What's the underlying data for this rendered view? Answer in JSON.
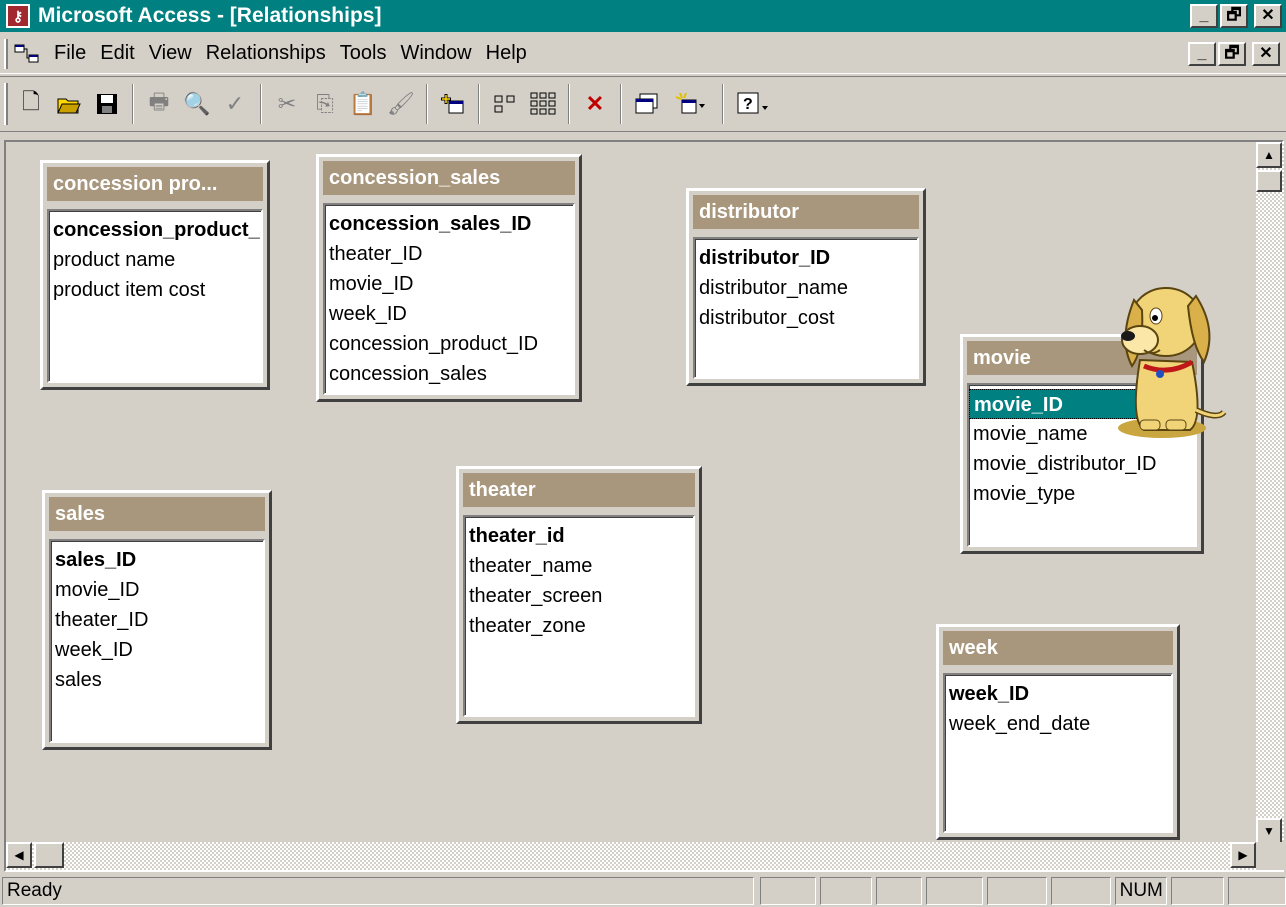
{
  "window": {
    "title": "Microsoft Access - [Relationships]",
    "app_icon": "access-key-icon",
    "minimize": "_",
    "maximize": "🗗",
    "close": "✕"
  },
  "menu": {
    "items": [
      {
        "label": "File"
      },
      {
        "label": "Edit"
      },
      {
        "label": "View"
      },
      {
        "label": "Relationships"
      },
      {
        "label": "Tools"
      },
      {
        "label": "Window"
      },
      {
        "label": "Help"
      }
    ]
  },
  "toolbar": {
    "buttons": [
      "new-icon",
      "open-icon",
      "save-icon",
      "print-icon",
      "print-preview-icon",
      "spelling-icon",
      "cut-icon",
      "copy-icon",
      "paste-icon",
      "format-painter-icon",
      "show-table-icon",
      "show-direct-icon",
      "show-all-icon",
      "delete-icon",
      "database-window-icon",
      "new-object-icon",
      "help-icon"
    ]
  },
  "tables": {
    "concession_product": {
      "title": "concession pro...",
      "fields": [
        "concession_product_",
        "product name",
        "product item cost"
      ]
    },
    "concession_sales": {
      "title": "concession_sales",
      "fields": [
        "concession_sales_ID",
        "theater_ID",
        "movie_ID",
        "week_ID",
        "concession_product_ID",
        "concession_sales"
      ]
    },
    "distributor": {
      "title": "distributor",
      "fields": [
        "distributor_ID",
        "distributor_name",
        "distributor_cost"
      ]
    },
    "movie": {
      "title": "movie",
      "fields": [
        "movie_ID",
        "movie_name",
        "movie_distributor_ID",
        "movie_type"
      ]
    },
    "sales": {
      "title": "sales",
      "fields": [
        "sales_ID",
        "movie_ID",
        "theater_ID",
        "week_ID",
        "sales"
      ]
    },
    "theater": {
      "title": "theater",
      "fields": [
        "theater_id",
        "theater_name",
        "theater_screen",
        "theater_zone"
      ]
    },
    "week": {
      "title": "week",
      "fields": [
        "week_ID",
        "week_end_date"
      ]
    }
  },
  "statusbar": {
    "message": "Ready",
    "num": "NUM"
  },
  "colors": {
    "titlebar": "#008080",
    "table_header": "#a8977c",
    "selection": "#008080"
  }
}
